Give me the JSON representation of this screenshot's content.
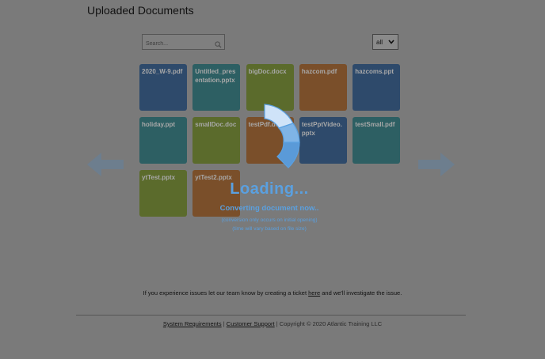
{
  "page": {
    "title": "Uploaded Documents"
  },
  "search": {
    "placeholder": "Search..."
  },
  "filter": {
    "selected": "all"
  },
  "documents": [
    {
      "name": "2020_W-9.pdf",
      "color": "#2e4a6b"
    },
    {
      "name": "Untitled_presentation.pptx",
      "color": "#2d5f63"
    },
    {
      "name": "bigDoc.docx",
      "color": "#5b6b2c"
    },
    {
      "name": "hazcom.pdf",
      "color": "#7a4f2a"
    },
    {
      "name": "hazcoms.ppt",
      "color": "#2e4a6b"
    },
    {
      "name": "holiday.ppt",
      "color": "#2d5f63"
    },
    {
      "name": "smallDoc.doc",
      "color": "#5b6b2c"
    },
    {
      "name": "testPdf.docx",
      "color": "#7a4f2a"
    },
    {
      "name": "testPptVideo.pptx",
      "color": "#2e4a6b"
    },
    {
      "name": "testSmall.pdf",
      "color": "#2d5f63"
    },
    {
      "name": "ytTest.pptx",
      "color": "#5b6b2c"
    },
    {
      "name": "ytTest2.pptx",
      "color": "#7a4f2a"
    }
  ],
  "loading": {
    "title": "Loading...",
    "message": "Converting document now..",
    "note1": "(conversion only occurs on initial opening)",
    "note2": "(time will vary based on file size)",
    "color": "#5aa0e0"
  },
  "issue": {
    "prefix": "If you experience issues let our team know by creating a ticket",
    "link": "here",
    "suffix": "and we'll investigate the issue."
  },
  "footer": {
    "system_requirements": "System Requirements",
    "sep1": "|",
    "customer_support": "Customer Support",
    "copyright": "| Copyright © 2020 Atlantic Training LLC"
  }
}
